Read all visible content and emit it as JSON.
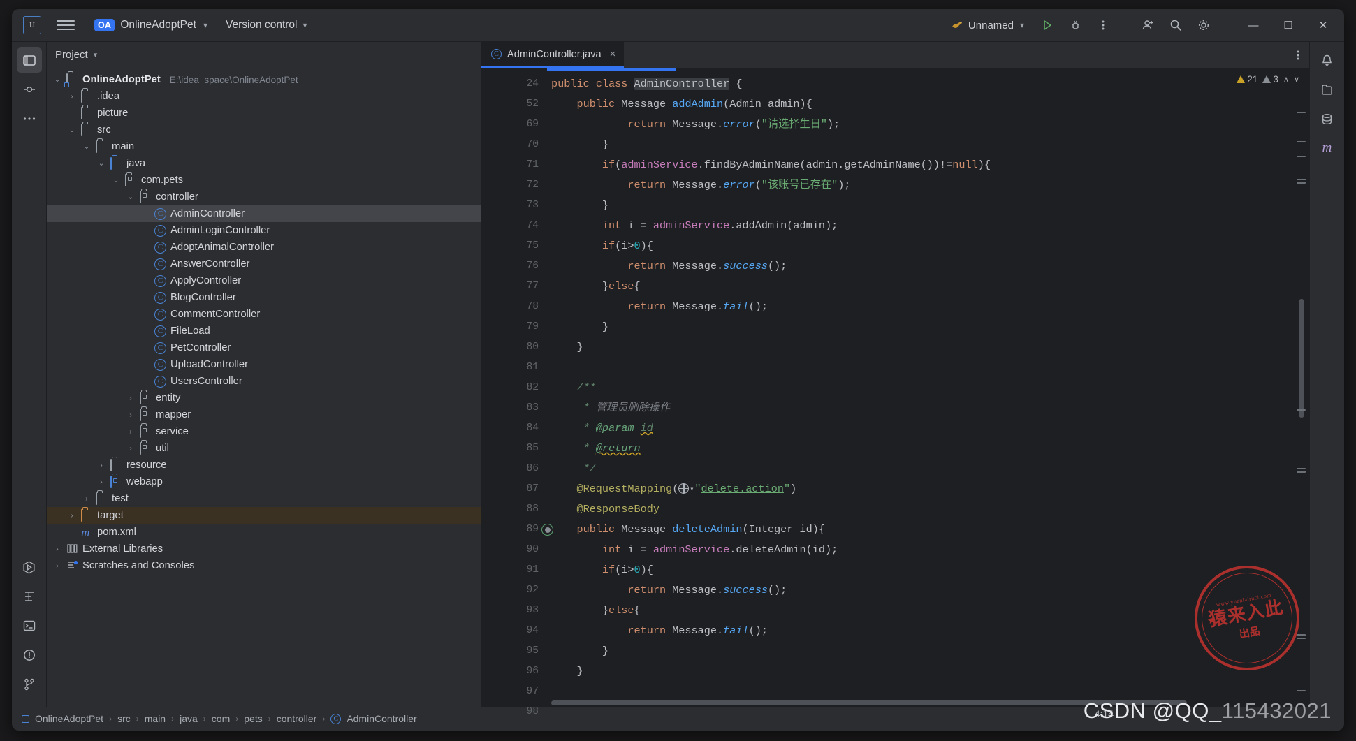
{
  "titlebar": {
    "logo": "ij-logo",
    "menu_icon": "hamburger-menu-icon",
    "project_badge": "OA",
    "project_name": "OnlineAdoptPet",
    "vcs_label": "Version control",
    "run_config": "Unnamed",
    "run_icon": "run-icon",
    "debug_icon": "debug-icon",
    "more_icon": "more-vertical-icon",
    "account_icon": "account-icon",
    "search_icon": "search-icon",
    "settings_icon": "settings-gear-icon",
    "minimize": "—",
    "maximize": "☐",
    "close": "✕"
  },
  "project_panel": {
    "title": "Project",
    "tree": [
      {
        "depth": 0,
        "arrow": "down",
        "icon": "folder-module",
        "label": "OnlineAdoptPet",
        "bold": true,
        "path": "E:\\idea_space\\OnlineAdoptPet"
      },
      {
        "depth": 1,
        "arrow": "right",
        "icon": "folder",
        "label": ".idea"
      },
      {
        "depth": 1,
        "arrow": "none",
        "icon": "folder",
        "label": "picture"
      },
      {
        "depth": 1,
        "arrow": "down",
        "icon": "folder",
        "label": "src"
      },
      {
        "depth": 2,
        "arrow": "down",
        "icon": "folder",
        "label": "main"
      },
      {
        "depth": 3,
        "arrow": "down",
        "icon": "folder-blue",
        "label": "java"
      },
      {
        "depth": 4,
        "arrow": "down",
        "icon": "package",
        "label": "com.pets"
      },
      {
        "depth": 5,
        "arrow": "down",
        "icon": "package",
        "label": "controller"
      },
      {
        "depth": 6,
        "arrow": "none",
        "icon": "class",
        "label": "AdminController",
        "selected": true
      },
      {
        "depth": 6,
        "arrow": "none",
        "icon": "class",
        "label": "AdminLoginController"
      },
      {
        "depth": 6,
        "arrow": "none",
        "icon": "class",
        "label": "AdoptAnimalController"
      },
      {
        "depth": 6,
        "arrow": "none",
        "icon": "class",
        "label": "AnswerController"
      },
      {
        "depth": 6,
        "arrow": "none",
        "icon": "class",
        "label": "ApplyController"
      },
      {
        "depth": 6,
        "arrow": "none",
        "icon": "class",
        "label": "BlogController"
      },
      {
        "depth": 6,
        "arrow": "none",
        "icon": "class",
        "label": "CommentController"
      },
      {
        "depth": 6,
        "arrow": "none",
        "icon": "class",
        "label": "FileLoad"
      },
      {
        "depth": 6,
        "arrow": "none",
        "icon": "class",
        "label": "PetController"
      },
      {
        "depth": 6,
        "arrow": "none",
        "icon": "class",
        "label": "UploadController"
      },
      {
        "depth": 6,
        "arrow": "none",
        "icon": "class",
        "label": "UsersController"
      },
      {
        "depth": 5,
        "arrow": "right",
        "icon": "package",
        "label": "entity"
      },
      {
        "depth": 5,
        "arrow": "right",
        "icon": "package",
        "label": "mapper"
      },
      {
        "depth": 5,
        "arrow": "right",
        "icon": "package",
        "label": "service"
      },
      {
        "depth": 5,
        "arrow": "right",
        "icon": "package",
        "label": "util"
      },
      {
        "depth": 3,
        "arrow": "right",
        "icon": "folder",
        "label": "resource"
      },
      {
        "depth": 3,
        "arrow": "right",
        "icon": "folder-web",
        "label": "webapp"
      },
      {
        "depth": 2,
        "arrow": "right",
        "icon": "folder",
        "label": "test"
      },
      {
        "depth": 1,
        "arrow": "right",
        "icon": "folder-orange",
        "label": "target",
        "highlight": true
      },
      {
        "depth": 1,
        "arrow": "none",
        "icon": "maven",
        "label": "pom.xml"
      },
      {
        "depth": 0,
        "arrow": "right",
        "icon": "library",
        "label": "External Libraries"
      },
      {
        "depth": 0,
        "arrow": "right",
        "icon": "scratches",
        "label": "Scratches and Consoles"
      }
    ]
  },
  "editor": {
    "tab": {
      "label": "AdminController.java",
      "icon": "java-class-icon",
      "close": "×"
    },
    "more_icon": "editor-more-icon",
    "inspections": {
      "warning_count": "21",
      "weak_count": "3",
      "up": "∧",
      "down": "∨"
    },
    "lines": [
      {
        "no": "24"
      },
      {
        "no": "52"
      },
      {
        "no": "69"
      },
      {
        "no": "70"
      },
      {
        "no": "71"
      },
      {
        "no": "72"
      },
      {
        "no": "73"
      },
      {
        "no": "74"
      },
      {
        "no": "75"
      },
      {
        "no": "76"
      },
      {
        "no": "77"
      },
      {
        "no": "78"
      },
      {
        "no": "79"
      },
      {
        "no": "80"
      },
      {
        "no": "81"
      },
      {
        "no": "82"
      },
      {
        "no": "83"
      },
      {
        "no": "84"
      },
      {
        "no": "85"
      },
      {
        "no": "86"
      },
      {
        "no": "87"
      },
      {
        "no": "88"
      },
      {
        "no": "89",
        "gutter_icon": "web-request-mapping-icon"
      },
      {
        "no": "90"
      },
      {
        "no": "91"
      },
      {
        "no": "92"
      },
      {
        "no": "93"
      },
      {
        "no": "94"
      },
      {
        "no": "95"
      },
      {
        "no": "96"
      },
      {
        "no": "97"
      },
      {
        "no": "98"
      }
    ],
    "code_text": [
      "public class AdminController {",
      "    public Message addAdmin(Admin admin){",
      "            return Message.error(\"请选择生日\");",
      "        }",
      "        if(adminService.findByAdminName(admin.getAdminName())!=null){",
      "            return Message.error(\"该账号已存在\");",
      "        }",
      "        int i = adminService.addAdmin(admin);",
      "        if(i>0){",
      "            return Message.success();",
      "        }else{",
      "            return Message.fail();",
      "        }",
      "    }",
      "",
      "    /**",
      "     * 管理员删除操作",
      "     * @param id",
      "     * @return",
      "     */",
      "    @RequestMapping(\"delete.action\")",
      "    @ResponseBody",
      "    public Message deleteAdmin(Integer id){",
      "        int i = adminService.deleteAdmin(id);",
      "        if(i>0){",
      "            return Message.success();",
      "        }else{",
      "            return Message.fail();",
      "        }",
      "    }",
      "",
      ""
    ]
  },
  "statusbar": {
    "breadcrumb": [
      {
        "icon": "module-icon",
        "label": "OnlineAdoptPet"
      },
      {
        "icon": null,
        "label": "src"
      },
      {
        "icon": null,
        "label": "main"
      },
      {
        "icon": null,
        "label": "java"
      },
      {
        "icon": null,
        "label": "com"
      },
      {
        "icon": null,
        "label": "pets"
      },
      {
        "icon": null,
        "label": "controller"
      },
      {
        "icon": "class-icon",
        "label": "AdminController"
      }
    ],
    "separator": "›"
  },
  "watermark": {
    "stamp_top": "www.yuanlairuci.com",
    "stamp_mid": "猿来入此",
    "stamp_bot": "出品",
    "csdn_text": "CSDN @QQ_",
    "csdn_blur": "115432021",
    "clock": "4:14"
  },
  "leftbar_icons": [
    "project-icon",
    "commit-icon",
    "more-tools-icon",
    "run-panel-icon",
    "structure-icon",
    "terminal-icon",
    "problems-icon",
    "vcs-branch-icon"
  ],
  "rightbar_icons": [
    "notifications-icon",
    "maven-icon",
    "database-icon",
    "ai-assistant-icon"
  ]
}
